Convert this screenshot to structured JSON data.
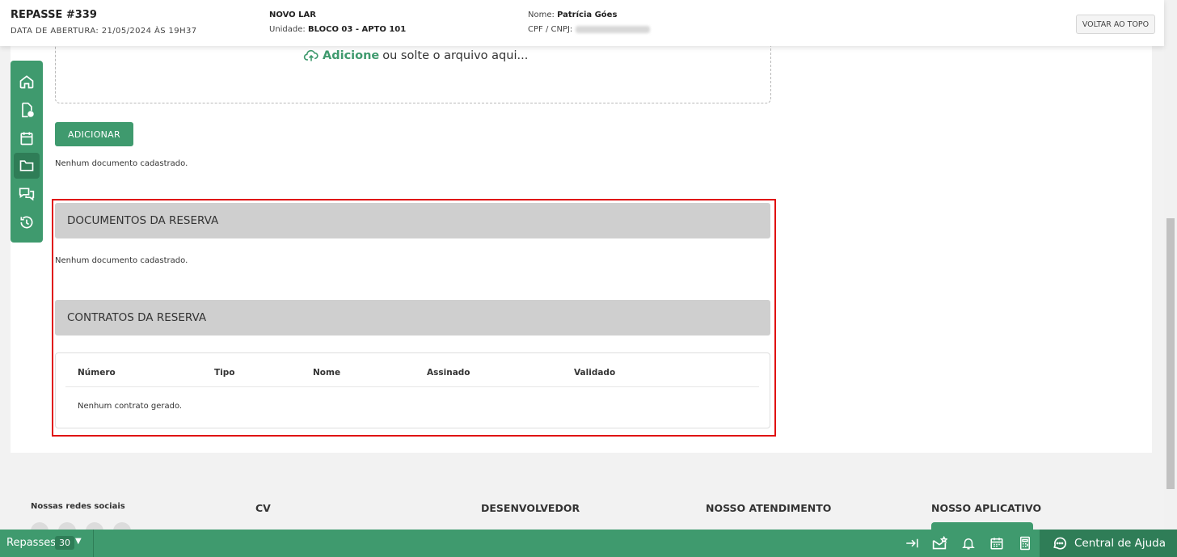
{
  "header": {
    "title": "REPASSE #339",
    "opened": "DATA DE ABERTURA: 21/05/2024 ÀS 19H37",
    "project": "NOVO LAR",
    "unit_label": "Unidade:",
    "unit_value": "BLOCO 03 - APTO 101",
    "name_label": "Nome:",
    "name_value": "Patrícia Góes",
    "doc_label": "CPF / CNPJ:",
    "back_top": "VOLTAR AO TOPO"
  },
  "upload": {
    "add_link": "Adicione",
    "drop_text": "ou solte o arquivo aqui...",
    "add_button": "ADICIONAR",
    "empty": "Nenhum documento cadastrado."
  },
  "reserva_docs": {
    "title": "DOCUMENTOS DA RESERVA",
    "empty": "Nenhum documento cadastrado."
  },
  "contratos": {
    "title": "CONTRATOS DA RESERVA",
    "columns": [
      "Número",
      "Tipo",
      "Nome",
      "Assinado",
      "Validado"
    ],
    "empty": "Nenhum contrato gerado."
  },
  "footer": {
    "social": "Nossas redes sociais",
    "col1": "CV",
    "col2": "DESENVOLVEDOR",
    "col3": "NOSSO ATENDIMENTO",
    "col4": "NOSSO APLICATIVO"
  },
  "bottom_bar": {
    "label": "Repasses",
    "count": "30",
    "help": "Central de Ajuda"
  },
  "sidebar_icons": [
    "home-icon",
    "document-icon",
    "calendar-icon",
    "folder-icon",
    "chat-icon",
    "history-icon"
  ],
  "colors": {
    "primary": "#3f9a6e",
    "primary_dark": "#2f7d57",
    "highlight": "#e01010",
    "section_bg": "#cfcfcf"
  }
}
